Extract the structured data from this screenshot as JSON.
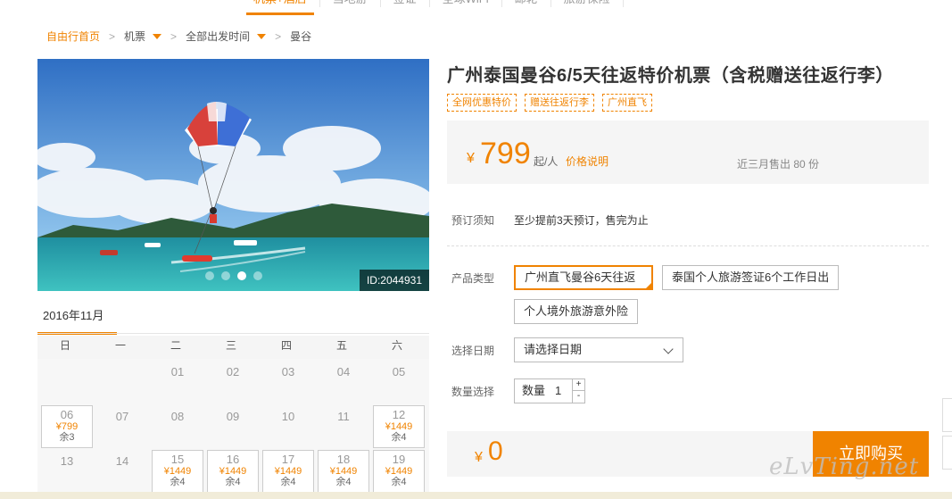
{
  "topnav": {
    "items": [
      {
        "label": "机票+酒店"
      },
      {
        "label": "当地游"
      },
      {
        "label": "签证"
      },
      {
        "label": "全球WiFi"
      },
      {
        "label": "邮轮"
      },
      {
        "label": "旅游保险"
      }
    ]
  },
  "breadcrumb": {
    "home": "自由行首页",
    "category": "机票",
    "time": "全部出发时间",
    "destination": "曼谷",
    "separator": ">"
  },
  "hero": {
    "image_id": "ID:2044931",
    "slides": 4,
    "active_slide": 3
  },
  "calendar": {
    "month": "2016年11月",
    "weekdays": [
      "日",
      "一",
      "二",
      "三",
      "四",
      "五",
      "六"
    ],
    "days": {
      "d01": "01",
      "d02": "02",
      "d03": "03",
      "d04": "04",
      "d05": "05",
      "d06": "06",
      "d07": "07",
      "d08": "08",
      "d09": "09",
      "d10": "10",
      "d11": "11",
      "d12": "12",
      "d13": "13",
      "d14": "14",
      "d15": "15",
      "d16": "16",
      "d17": "17",
      "d18": "18",
      "d19": "19"
    },
    "prices": {
      "d06": "¥799",
      "d12": "¥1449",
      "d15": "¥1449",
      "d16": "¥1449",
      "d17": "¥1449",
      "d18": "¥1449",
      "d19": "¥1449"
    },
    "remaining": {
      "d06": "余3",
      "d12": "余4",
      "d15": "余4",
      "d16": "余4",
      "d17": "余4",
      "d18": "余4",
      "d19": "余4"
    }
  },
  "product": {
    "title": "广州泰国曼谷6/5天往返特价机票（含税赠送往返行李）",
    "tags": [
      "全网优惠特价",
      "赠送往返行李",
      "广州直飞"
    ]
  },
  "price": {
    "currency": "¥",
    "amount": "799",
    "unit": "起/人",
    "note": "价格说明",
    "sold": "近三月售出 80 份"
  },
  "booking": {
    "notice_label": "预订须知",
    "notice_text": "至少提前3天预订，售完为止",
    "type_label": "产品类型",
    "types": [
      "广州直飞曼谷6天往返",
      "泰国个人旅游签证6个工作日出",
      "个人境外旅游意外险"
    ],
    "date_label": "选择日期",
    "date_placeholder": "请选择日期",
    "qty_label": "数量选择",
    "qty_text": "数量",
    "qty_value": "1",
    "plus": "+",
    "minus": "-"
  },
  "total": {
    "currency": "¥",
    "amount": "0",
    "buy_label": "立即购买"
  },
  "watermark": "eLvTing.net",
  "colors": {
    "accent": "#f08300",
    "panel": "#f5f5f5"
  }
}
